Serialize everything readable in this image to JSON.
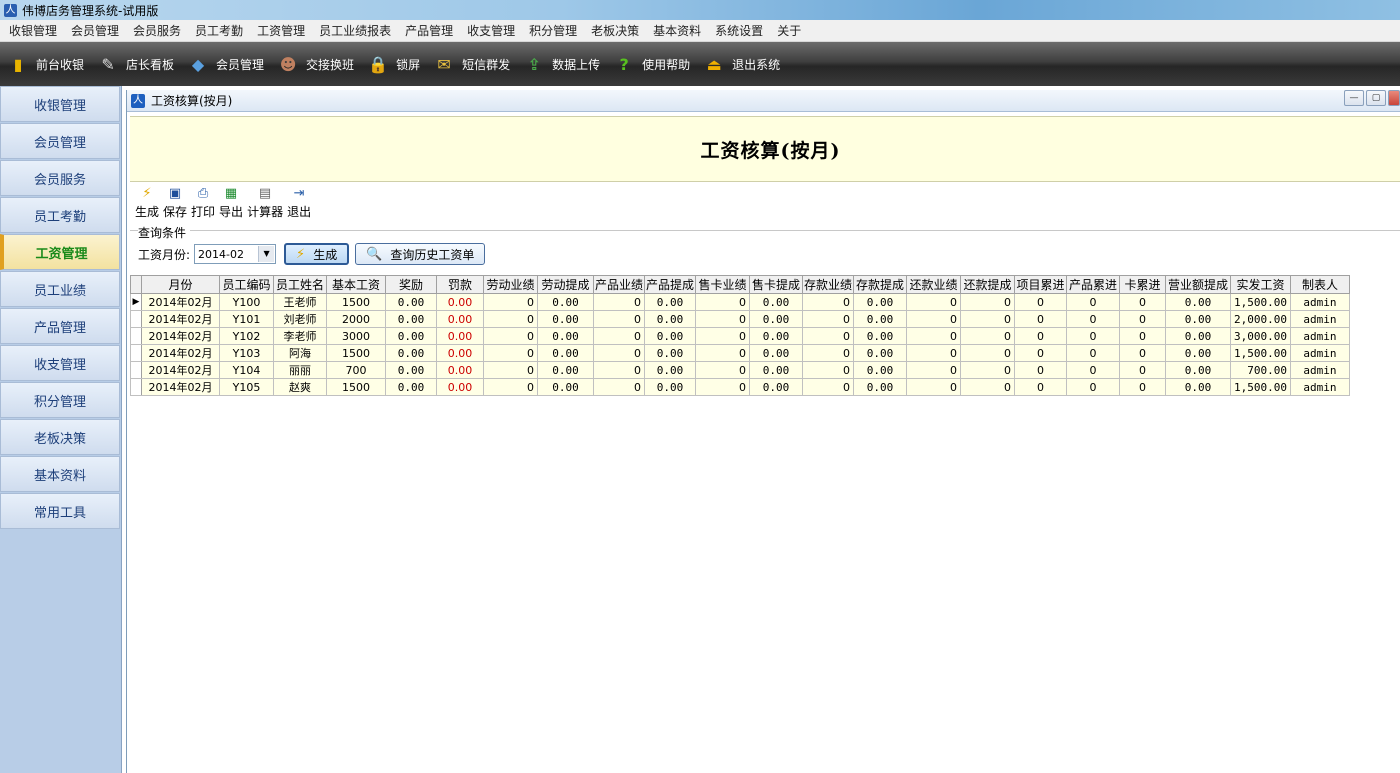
{
  "window": {
    "title": "伟博店务管理系统-试用版"
  },
  "menubar": [
    "收银管理",
    "会员管理",
    "会员服务",
    "员工考勤",
    "工资管理",
    "员工业绩报表",
    "产品管理",
    "收支管理",
    "积分管理",
    "老板决策",
    "基本资料",
    "系统设置",
    "关于"
  ],
  "toolbar": [
    {
      "label": "前台收银",
      "icon": "coins-icon",
      "color": "#e8b400"
    },
    {
      "label": "店长看板",
      "icon": "pencil-icon",
      "color": "#dcdcdc"
    },
    {
      "label": "会员管理",
      "icon": "card-icon",
      "color": "#5aa0e0"
    },
    {
      "label": "交接换班",
      "icon": "people-icon",
      "color": "#c08060"
    },
    {
      "label": "锁屏",
      "icon": "lock-icon",
      "color": "#d8a020"
    },
    {
      "label": "短信群发",
      "icon": "sms-icon",
      "color": "#e8c040"
    },
    {
      "label": "数据上传",
      "icon": "upload-icon",
      "color": "#4aa84a"
    },
    {
      "label": "使用帮助",
      "icon": "help-icon",
      "color": "#58c020"
    },
    {
      "label": "退出系统",
      "icon": "exit-icon",
      "color": "#f0b000"
    }
  ],
  "leftnav": {
    "items": [
      "收银管理",
      "会员管理",
      "会员服务",
      "员工考勤",
      "工资管理",
      "员工业绩",
      "产品管理",
      "收支管理",
      "积分管理",
      "老板决策",
      "基本资料",
      "常用工具"
    ],
    "active": "工资管理"
  },
  "child": {
    "title": "工资核算(按月)",
    "header": "工资核算(按月)",
    "tools": [
      {
        "label": "生成",
        "icon": "lightning-icon"
      },
      {
        "label": "保存",
        "icon": "save-icon"
      },
      {
        "label": "打印",
        "icon": "print-icon"
      },
      {
        "label": "导出",
        "icon": "excel-icon"
      },
      {
        "label": "计算器",
        "icon": "calculator-icon"
      },
      {
        "label": "退出",
        "icon": "exit-icon"
      }
    ],
    "query": {
      "legend": "查询条件",
      "month_label": "工资月份:",
      "month_value": "2014-02",
      "generate_label": "生成",
      "history_label": "查询历史工资单"
    }
  },
  "grid": {
    "columns": [
      "月份",
      "员工编码",
      "员工姓名",
      "基本工资",
      "奖励",
      "罚款",
      "劳动业绩",
      "劳动提成",
      "产品业绩",
      "产品提成",
      "售卡业绩",
      "售卡提成",
      "存款业绩",
      "存款提成",
      "还款业绩",
      "还款提成",
      "项目累进",
      "产品累进",
      "卡累进",
      "营业额提成",
      "实发工资",
      "制表人"
    ],
    "rows": [
      [
        "2014年02月",
        "Y100",
        "王老师",
        "1500",
        "0.00",
        "0.00",
        "0",
        "0.00",
        "0",
        "0.00",
        "0",
        "0.00",
        "0",
        "0.00",
        "0",
        "0",
        "0",
        "0",
        "0",
        "0.00",
        "1,500.00",
        "admin"
      ],
      [
        "2014年02月",
        "Y101",
        "刘老师",
        "2000",
        "0.00",
        "0.00",
        "0",
        "0.00",
        "0",
        "0.00",
        "0",
        "0.00",
        "0",
        "0.00",
        "0",
        "0",
        "0",
        "0",
        "0",
        "0.00",
        "2,000.00",
        "admin"
      ],
      [
        "2014年02月",
        "Y102",
        "李老师",
        "3000",
        "0.00",
        "0.00",
        "0",
        "0.00",
        "0",
        "0.00",
        "0",
        "0.00",
        "0",
        "0.00",
        "0",
        "0",
        "0",
        "0",
        "0",
        "0.00",
        "3,000.00",
        "admin"
      ],
      [
        "2014年02月",
        "Y103",
        "阿海",
        "1500",
        "0.00",
        "0.00",
        "0",
        "0.00",
        "0",
        "0.00",
        "0",
        "0.00",
        "0",
        "0.00",
        "0",
        "0",
        "0",
        "0",
        "0",
        "0.00",
        "1,500.00",
        "admin"
      ],
      [
        "2014年02月",
        "Y104",
        "丽丽",
        "700",
        "0.00",
        "0.00",
        "0",
        "0.00",
        "0",
        "0.00",
        "0",
        "0.00",
        "0",
        "0.00",
        "0",
        "0",
        "0",
        "0",
        "0",
        "0.00",
        "700.00",
        "admin"
      ],
      [
        "2014年02月",
        "Y105",
        "赵爽",
        "1500",
        "0.00",
        "0.00",
        "0",
        "0.00",
        "0",
        "0.00",
        "0",
        "0.00",
        "0",
        "0.00",
        "0",
        "0",
        "0",
        "0",
        "0",
        "0.00",
        "1,500.00",
        "admin"
      ]
    ],
    "selected_row": 0,
    "penalty_color": "#cc0000"
  }
}
